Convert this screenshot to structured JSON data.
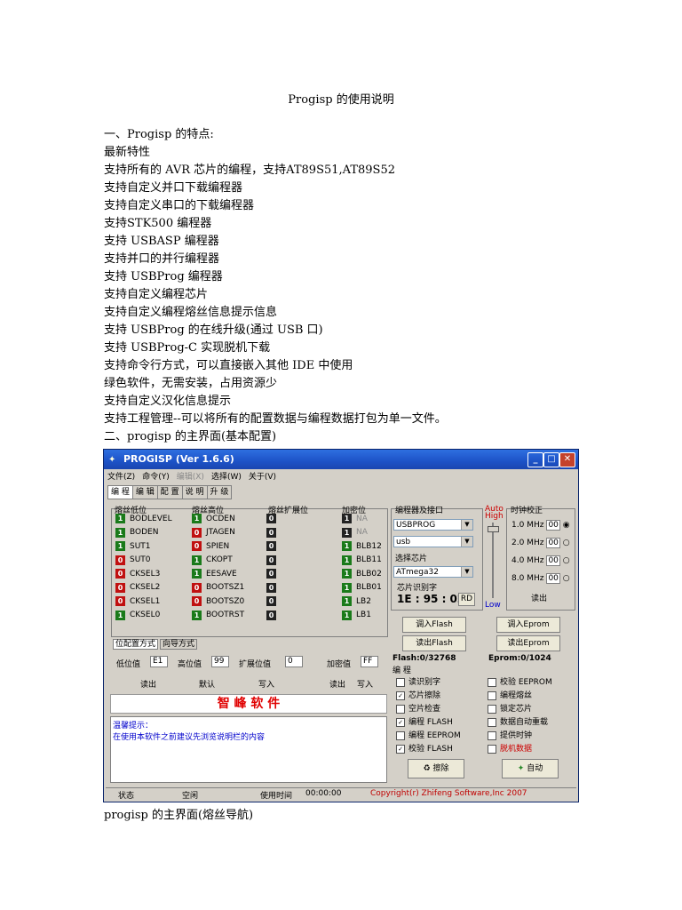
{
  "doc": {
    "title": "Progisp 的使用说明",
    "lines": [
      "一、Progisp 的特点:",
      "最新特性",
      "支持所有的 AVR 芯片的编程，支持AT89S51,AT89S52",
      "支持自定义并口下载编程器",
      "支持自定义串口的下载编程器",
      "支持STK500 编程器",
      "支持 USBASP 编程器",
      "支持并口的并行编程器",
      "支持 USBProg 编程器",
      "支持自定义编程芯片",
      "支持自定义编程熔丝信息提示信息",
      "支持 USBProg 的在线升级(通过 USB 口)",
      "支持 USBProg-C 实现脱机下载",
      "支持命令行方式，可以直接嵌入其他 IDE 中使用",
      "绿色软件，无需安装，占用资源少",
      "支持自定义汉化信息提示",
      "支持工程管理--可以将所有的配置数据与编程数据打包为单一文件。",
      "二、progisp 的主界面(基本配置)"
    ],
    "caption": "progisp 的主界面(熔丝导航)"
  },
  "app": {
    "title": "PROGISP (Ver 1.6.6)",
    "menu": [
      "文件(Z)",
      "命令(Y)",
      "编辑(X)",
      "选择(W)",
      "关于(V)"
    ],
    "tabs": [
      "编 程",
      "编 辑",
      "配 置",
      "说 明",
      "升 级"
    ],
    "fuse_groups": [
      "熔丝低位",
      "熔丝高位",
      "熔丝扩展位",
      "加密位"
    ],
    "fuse_low": [
      {
        "v": "1",
        "c": "g",
        "n": "BODLEVEL"
      },
      {
        "v": "1",
        "c": "g",
        "n": "BODEN"
      },
      {
        "v": "1",
        "c": "g",
        "n": "SUT1"
      },
      {
        "v": "0",
        "c": "r",
        "n": "SUT0"
      },
      {
        "v": "0",
        "c": "r",
        "n": "CKSEL3"
      },
      {
        "v": "0",
        "c": "r",
        "n": "CKSEL2"
      },
      {
        "v": "0",
        "c": "r",
        "n": "CKSEL1"
      },
      {
        "v": "1",
        "c": "g",
        "n": "CKSEL0"
      }
    ],
    "fuse_high": [
      {
        "v": "1",
        "c": "g",
        "n": "OCDEN"
      },
      {
        "v": "0",
        "c": "r",
        "n": "JTAGEN"
      },
      {
        "v": "0",
        "c": "r",
        "n": "SPIEN"
      },
      {
        "v": "1",
        "c": "g",
        "n": "CKOPT"
      },
      {
        "v": "1",
        "c": "g",
        "n": "EESAVE"
      },
      {
        "v": "0",
        "c": "r",
        "n": "BOOTSZ1"
      },
      {
        "v": "0",
        "c": "r",
        "n": "BOOTSZ0"
      },
      {
        "v": "1",
        "c": "g",
        "n": "BOOTRST"
      }
    ],
    "fuse_ext": [
      {
        "v": "0"
      },
      {
        "v": "0"
      },
      {
        "v": "0"
      },
      {
        "v": "0"
      },
      {
        "v": "0"
      },
      {
        "v": "0"
      },
      {
        "v": "0"
      },
      {
        "v": "0"
      }
    ],
    "lock": [
      {
        "v": "1",
        "c": "k",
        "n": "NA",
        "grey": true
      },
      {
        "v": "1",
        "c": "k",
        "n": "NA",
        "grey": true
      },
      {
        "v": "1",
        "c": "g",
        "n": "BLB12"
      },
      {
        "v": "1",
        "c": "g",
        "n": "BLB11"
      },
      {
        "v": "1",
        "c": "g",
        "n": "BLB02"
      },
      {
        "v": "1",
        "c": "g",
        "n": "BLB01"
      },
      {
        "v": "1",
        "c": "g",
        "n": "LB2"
      },
      {
        "v": "1",
        "c": "g",
        "n": "LB1"
      }
    ],
    "subtabs": [
      "位配置方式",
      "向导方式"
    ],
    "fields": {
      "low_label": "低位值",
      "low": "E1",
      "high_label": "高位值",
      "high": "99",
      "ext_label": "扩展位值",
      "ext": "0",
      "lock_label": "加密值",
      "lock": "FF"
    },
    "fuse_buttons": [
      "读出",
      "默认",
      "写入"
    ],
    "lock_buttons": [
      "读出",
      "写入"
    ],
    "brand": "智 峰 软 件",
    "tip_title": "温馨提示：",
    "tip_text": "在使用本软件之前建议先浏览说明栏的内容",
    "programmer_label": "编程器及接口",
    "programmer": "USBPROG",
    "port": "usb",
    "chip_label": "选择芯片",
    "chip": "ATmega32",
    "sig_label": "芯片识别字",
    "sig": "1E : 95 : 02",
    "rd": "RD",
    "speed_auto": "Auto",
    "speed_high": "High",
    "speed_low": "Low",
    "clock_label": "时钟校正",
    "clocks": [
      "1.0 MHz",
      "2.0 MHz",
      "4.0 MHz",
      "8.0 MHz"
    ],
    "clock_vals": [
      "00",
      "00",
      "00",
      "00"
    ],
    "clock_read": "读出",
    "buttons": {
      "load_flash": "调入Flash",
      "load_eprom": "调入Eprom",
      "read_flash": "读出Flash",
      "read_eprom": "读出Eprom",
      "erase": "擦除",
      "auto": "自动"
    },
    "flash_info": "Flash:0/32768",
    "eprom_info": "Eprom:0/1024",
    "prog_label": "编 程",
    "options_left": [
      {
        "t": "读识别字",
        "c": false
      },
      {
        "t": "芯片擦除",
        "c": true
      },
      {
        "t": "空片检查",
        "c": false
      },
      {
        "t": "编程 FLASH",
        "c": true
      },
      {
        "t": "编程 EEPROM",
        "c": false
      },
      {
        "t": "校验 FLASH",
        "c": true
      }
    ],
    "options_right": [
      {
        "t": "校验 EEPROM",
        "c": false
      },
      {
        "t": "编程熔丝",
        "c": false
      },
      {
        "t": "锁定芯片",
        "c": false
      },
      {
        "t": "数据自动重载",
        "c": false
      },
      {
        "t": "提供时钟",
        "c": false
      },
      {
        "t": "脱机数据",
        "c": false,
        "red": true
      }
    ],
    "status": {
      "label": "状态",
      "state": "空闲",
      "time_label": "使用时间",
      "time": "00:00:00",
      "copyright": "Copyright(r) Zhifeng Software,Inc 2007"
    },
    "colors": {
      "brand": "#e00000",
      "tip": "#0000cc",
      "copyright": "#c00000",
      "titlebar": "#1d52c7"
    }
  }
}
